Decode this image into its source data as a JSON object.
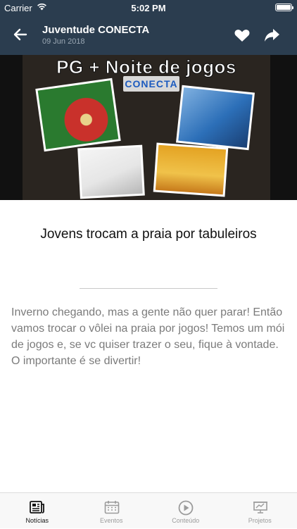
{
  "status_bar": {
    "carrier": "Carrier",
    "time": "5:02 PM"
  },
  "header": {
    "title": "Juventude CONECTA",
    "date": "09 Jun 2018",
    "icons": [
      "back-arrow-icon",
      "heart-icon",
      "share-icon"
    ]
  },
  "hero": {
    "banner_title": "PG + Noite de jogos",
    "logo_text": "CONECTA"
  },
  "article": {
    "headline": "Jovens trocam a praia por tabuleiros",
    "body": "Inverno chegando, mas a gente não quer parar! Então vamos trocar o vôlei na praia por jogos! Temos um mói de jogos e, se vc quiser trazer o seu, fique à vontade.  O importante é se divertir!"
  },
  "tabs": [
    {
      "label": "Notícias",
      "icon": "newspaper-icon",
      "active": true
    },
    {
      "label": "Eventos",
      "icon": "calendar-icon",
      "active": false
    },
    {
      "label": "Conteúdo",
      "icon": "play-icon",
      "active": false
    },
    {
      "label": "Projetos",
      "icon": "presentation-icon",
      "active": false
    }
  ],
  "colors": {
    "header_bg": "#2b3d4f",
    "tab_active": "#111111",
    "tab_inactive": "#9b9b9b"
  }
}
